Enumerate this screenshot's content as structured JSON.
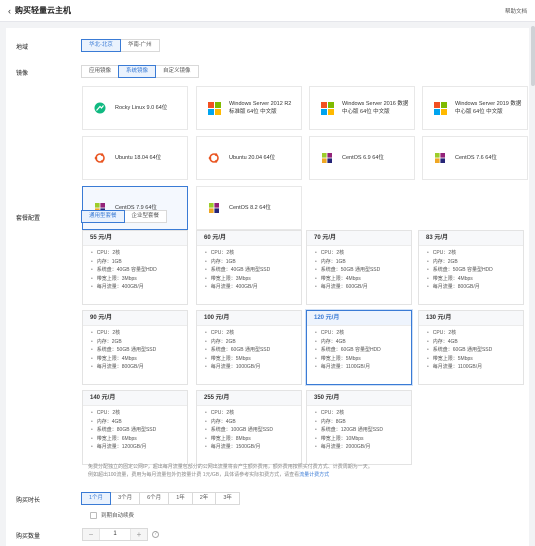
{
  "header": {
    "back_icon": "chevron-left-icon",
    "title": "购买轻量云主机",
    "help": "帮助文档"
  },
  "region": {
    "label": "地域",
    "options": [
      "华北-北京",
      "华南-广州"
    ],
    "selected": 0
  },
  "image": {
    "label": "镜像",
    "tabs": [
      "应用镜像",
      "系统镜像",
      "自定义镜像"
    ],
    "selected_tab": 1,
    "items": [
      {
        "line1": "Rocky Linux 9.0 64位",
        "line2": "",
        "icon": "rocky-linux-icon"
      },
      {
        "line1": "Windows Server 2012 R2",
        "line2": "标准版 64位 中文版",
        "icon": "windows-icon"
      },
      {
        "line1": "Windows Server 2016 数据",
        "line2": "中心版 64位 中文版",
        "icon": "windows-icon"
      },
      {
        "line1": "Windows Server 2019 数据",
        "line2": "中心版 64位 中文版",
        "icon": "windows-icon"
      },
      {
        "line1": "Ubuntu 18.04 64位",
        "line2": "",
        "icon": "ubuntu-icon"
      },
      {
        "line1": "Ubuntu 20.04 64位",
        "line2": "",
        "icon": "ubuntu-icon"
      },
      {
        "line1": "CentOS 6.9 64位",
        "line2": "",
        "icon": "centos-icon"
      },
      {
        "line1": "CentOS 7.6 64位",
        "line2": "",
        "icon": "centos-icon"
      },
      {
        "line1": "CentOS 7.9 64位",
        "line2": "",
        "icon": "centos-icon"
      },
      {
        "line1": "CentOS 8.2 64位",
        "line2": "",
        "icon": "centos-icon"
      }
    ],
    "selected_item": 8
  },
  "plans": {
    "label": "套餐配置",
    "tabs": [
      "通用型套餐",
      "企业型套餐"
    ],
    "selected_tab": 0,
    "selected_plan": 6,
    "items": [
      {
        "price": "55 元/月",
        "specs": [
          "CPU：2核",
          "内存：1GB",
          "系统盘：40GB 容量型HDD",
          "带宽上限：3Mbps",
          "每月流量：400GB/月"
        ]
      },
      {
        "price": "60 元/月",
        "specs": [
          "CPU：2核",
          "内存：1GB",
          "系统盘：40GB 通用型SSD",
          "带宽上限：3Mbps",
          "每月流量：400GB/月"
        ]
      },
      {
        "price": "70 元/月",
        "specs": [
          "CPU：2核",
          "内存：1GB",
          "系统盘：50GB 通用型SSD",
          "带宽上限：4Mbps",
          "每月流量：600GB/月"
        ]
      },
      {
        "price": "83 元/月",
        "specs": [
          "CPU：2核",
          "内存：2GB",
          "系统盘：50GB 容量型HDD",
          "带宽上限：4Mbps",
          "每月流量：800GB/月"
        ]
      },
      {
        "price": "90 元/月",
        "specs": [
          "CPU：2核",
          "内存：2GB",
          "系统盘：50GB 通用型SSD",
          "带宽上限：4Mbps",
          "每月流量：800GB/月"
        ]
      },
      {
        "price": "100 元/月",
        "specs": [
          "CPU：2核",
          "内存：2GB",
          "系统盘：60GB 通用型SSD",
          "带宽上限：5Mbps",
          "每月流量：1000GB/月"
        ]
      },
      {
        "price": "120 元/月",
        "specs": [
          "CPU：2核",
          "内存：4GB",
          "系统盘：60GB 容量型HDD",
          "带宽上限：5Mbps",
          "每月流量：1100GB/月"
        ]
      },
      {
        "price": "130 元/月",
        "specs": [
          "CPU：2核",
          "内存：4GB",
          "系统盘：60GB 通用型SSD",
          "带宽上限：5Mbps",
          "每月流量：1100GB/月"
        ]
      },
      {
        "price": "140 元/月",
        "specs": [
          "CPU：2核",
          "内存：4GB",
          "系统盘：80GB 通用型SSD",
          "带宽上限：6Mbps",
          "每月流量：1200GB/月"
        ]
      },
      {
        "price": "255 元/月",
        "specs": [
          "CPU：2核",
          "内存：4GB",
          "系统盘：100GB 通用型SSD",
          "带宽上限：8Mbps",
          "每月流量：1500GB/月"
        ]
      },
      {
        "price": "350 元/月",
        "specs": [
          "CPU：2核",
          "内存：8GB",
          "系统盘：120GB 通用型SSD",
          "带宽上限：10Mbps",
          "每月流量：2000GB/月"
        ]
      }
    ],
    "note_line1": "免费分配独立的固定公网IP，超出每月流量包部分的公网出流量将会产生额外费用，额外费用按照实付费方式、计费周期为一天。",
    "note_line2": "例如超出100流量，费用为每月流量包外仍按量计费 1元/GB，具体请参考实际扣费方式，请查看",
    "note_link": "流量计费方式"
  },
  "duration": {
    "label": "购买时长",
    "options": [
      "1个月",
      "3个月",
      "6个月",
      "1年",
      "2年",
      "3年"
    ],
    "selected": 0,
    "auto_renew": "到期自动续费"
  },
  "quantity": {
    "label": "购买数量",
    "value": "1",
    "minus": "−",
    "plus": "+",
    "help": "?"
  }
}
